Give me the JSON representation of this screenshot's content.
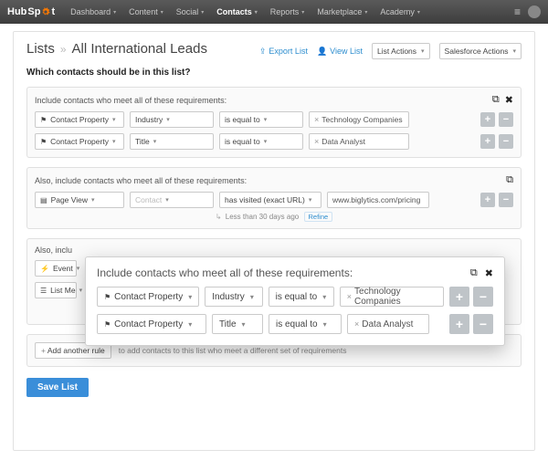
{
  "brand": {
    "part1": "Hub",
    "part2": "Sp",
    "part3": "t"
  },
  "nav": {
    "items": [
      {
        "label": "Dashboard"
      },
      {
        "label": "Content"
      },
      {
        "label": "Social"
      },
      {
        "label": "Contacts",
        "active": true
      },
      {
        "label": "Reports"
      },
      {
        "label": "Marketplace"
      },
      {
        "label": "Academy"
      }
    ]
  },
  "breadcrumb": {
    "root": "Lists",
    "sep": "»",
    "current": "All International Leads"
  },
  "header_actions": {
    "export": "Export List",
    "viewlist": "View List",
    "list_actions": "List Actions",
    "sf_actions": "Salesforce Actions"
  },
  "question": "Which contacts should be in this list?",
  "panel1": {
    "title": "Include contacts who meet all of these requirements:",
    "rows": [
      {
        "type": "Contact Property",
        "prop": "Industry",
        "op": "is equal to",
        "val": "Technology Companies"
      },
      {
        "type": "Contact Property",
        "prop": "Title",
        "op": "is equal to",
        "val": "Data Analyst"
      }
    ]
  },
  "panel2": {
    "title": "Also, include contacts who meet all of these requirements:",
    "rows": [
      {
        "type": "Page View",
        "prop_placeholder": "Contact",
        "op": "has visited (exact URL)",
        "val": "www.biglytics.com/pricing"
      }
    ],
    "refine_text": "Less than 30 days ago",
    "refine_btn": "Refine"
  },
  "panel3": {
    "title": "Also, inclu",
    "rows": [
      {
        "type": "Event"
      },
      {
        "type": "List Me"
      }
    ]
  },
  "addrule": {
    "button": "Add another rule",
    "hint": "to add contacts to this list who meet a different set of requirements"
  },
  "save": "Save List",
  "floating": {
    "title": "Include contacts who meet all of these requirements:",
    "rows": [
      {
        "type": "Contact Property",
        "prop": "Industry",
        "op": "is equal to",
        "val": "Technology Companies"
      },
      {
        "type": "Contact Property",
        "prop": "Title",
        "op": "is equal to",
        "val": "Data Analyst"
      }
    ]
  }
}
